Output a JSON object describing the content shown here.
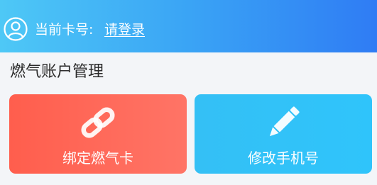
{
  "header": {
    "card_label": "当前卡号:",
    "login_link": "请登录",
    "avatar_icon": "user-icon"
  },
  "section": {
    "title": "燃气账户管理"
  },
  "tiles": [
    {
      "label": "绑定燃气卡",
      "icon": "link-icon",
      "color": "#ff6a5a"
    },
    {
      "label": "修改手机号",
      "icon": "pencil-icon",
      "color": "#33c2f7"
    }
  ],
  "colors": {
    "header_gradient_start": "#4ec8f6",
    "header_gradient_end": "#2f7cf4",
    "page_background": "#f3f5f8"
  }
}
